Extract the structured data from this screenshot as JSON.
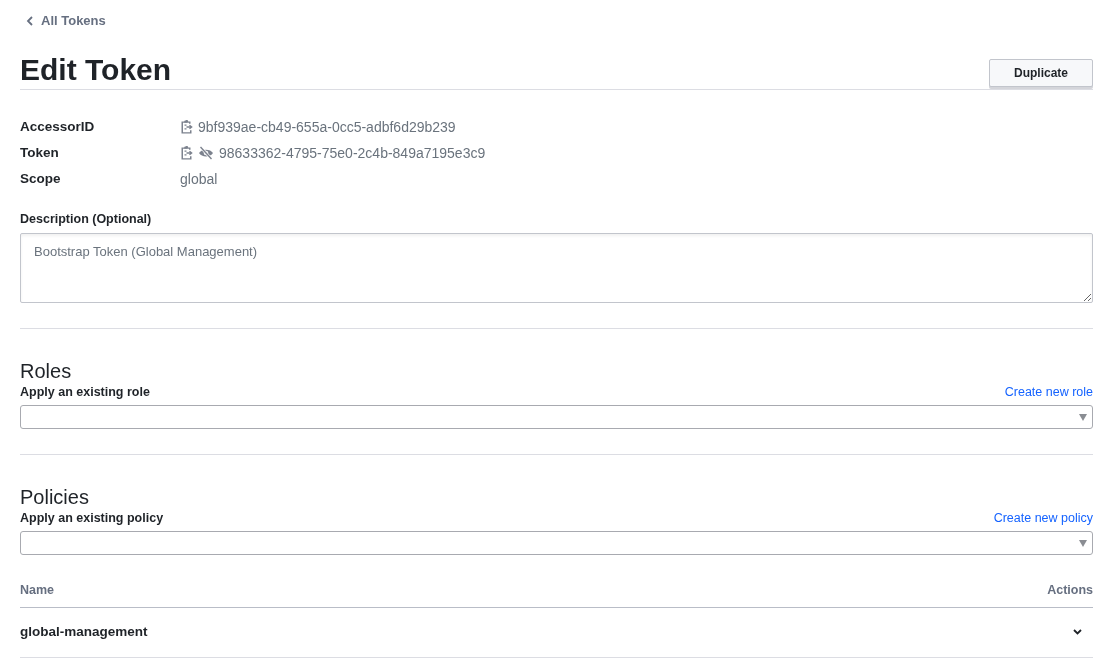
{
  "breadcrumb": {
    "label": "All Tokens"
  },
  "title": "Edit Token",
  "actions": [
    {
      "label": "Duplicate"
    }
  ],
  "details": [
    {
      "label": "AccessorID",
      "value": "9bf939ae-cb49-655a-0cc5-adbf6d29b239",
      "kind": "copy"
    },
    {
      "label": "Token",
      "value": "98633362-4795-75e0-2c4b-849a7195e3c9",
      "kind": "secret"
    },
    {
      "label": "Scope",
      "value": "global",
      "kind": "plain"
    }
  ],
  "description": {
    "label": "Description (Optional)",
    "value": "Bootstrap Token (Global Management)"
  },
  "roles": {
    "heading": "Roles",
    "label": "Apply an existing role",
    "create_link": "Create new role"
  },
  "policies": {
    "heading": "Policies",
    "label": "Apply an existing policy",
    "create_link": "Create new policy",
    "table": {
      "columns": [
        "Name",
        "Actions"
      ],
      "rows": [
        {
          "name": "global-management"
        }
      ]
    }
  }
}
